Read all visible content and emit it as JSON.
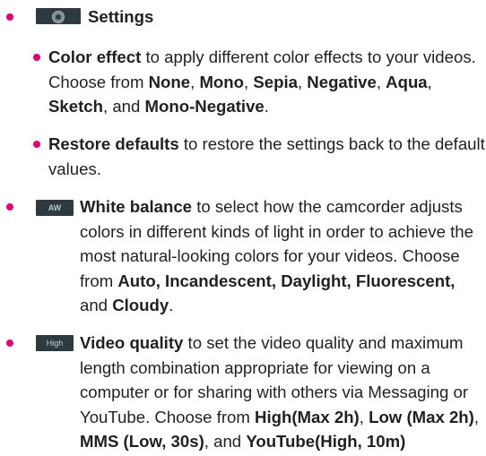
{
  "colors": {
    "bullet": "#e0007a",
    "text": "#231f20",
    "icon_bg": "#2d3b40"
  },
  "settings": {
    "icon": "settings-gear-icon",
    "label": "Settings"
  },
  "color_effect": {
    "term": "Color effect",
    "text1": " to apply different color effects to your videos. Choose from ",
    "opt1": "None",
    "sep1": ", ",
    "opt2": "Mono",
    "sep2": ", ",
    "opt3": "Sepia",
    "sep3": ", ",
    "opt4": "Negative",
    "sep4": ", ",
    "opt5": "Aqua",
    "sep5": ", ",
    "opt6": "Sketch",
    "sep6": ", and ",
    "opt7": "Mono-Negative",
    "end": "."
  },
  "restore_defaults": {
    "term": "Restore defaults",
    "text": " to restore the settings back to the default values."
  },
  "white_balance": {
    "icon_text": "AW",
    "term": "White balance",
    "text1": " to select how the camcorder adjusts colors in different kinds of light in order to achieve the most natural-looking colors for your videos. Choose from ",
    "opts": "Auto, Incandescent, Daylight, Fluorescent,",
    "and": " and ",
    "last": "Cloudy",
    "end": "."
  },
  "video_quality": {
    "icon_text": "High",
    "term": "Video quality",
    "text1": " to set the video quality and maximum length combination appropriate for viewing on a computer or for sharing with others via Messaging or YouTube. Choose from ",
    "opt1": "High(Max 2h)",
    "sep1": ", ",
    "opt2": "Low (Max 2h)",
    "sep2": ", ",
    "opt3": "MMS (Low, 30s)",
    "sep3": ", and ",
    "opt4": "YouTube(High, 10m)"
  }
}
